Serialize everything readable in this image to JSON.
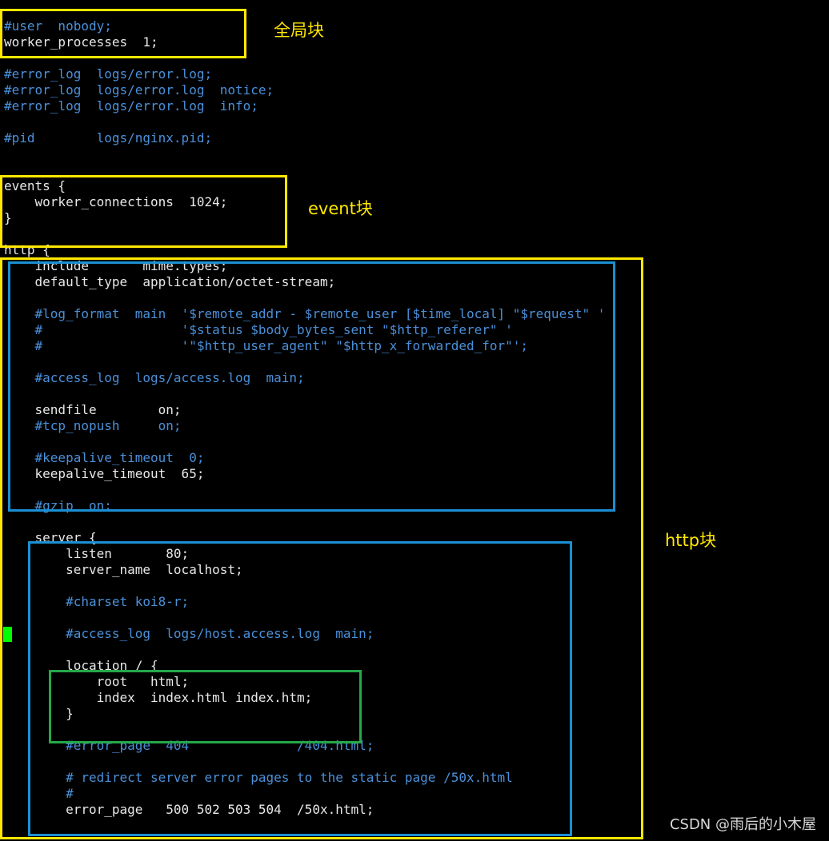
{
  "editor": {
    "lines": [
      {
        "text": "#user  nobody;",
        "kind": "comment"
      },
      {
        "text": "worker_processes  1;",
        "kind": "code"
      },
      {
        "text": "",
        "kind": "blank"
      },
      {
        "text": "#error_log  logs/error.log;",
        "kind": "comment"
      },
      {
        "text": "#error_log  logs/error.log  notice;",
        "kind": "comment"
      },
      {
        "text": "#error_log  logs/error.log  info;",
        "kind": "comment"
      },
      {
        "text": "",
        "kind": "blank"
      },
      {
        "text": "#pid        logs/nginx.pid;",
        "kind": "comment"
      },
      {
        "text": "",
        "kind": "blank"
      },
      {
        "text": "",
        "kind": "blank"
      },
      {
        "text": "events {",
        "kind": "code"
      },
      {
        "text": "    worker_connections  1024;",
        "kind": "code"
      },
      {
        "text": "}",
        "kind": "code"
      },
      {
        "text": "",
        "kind": "blank"
      },
      {
        "text": "http {",
        "kind": "code"
      },
      {
        "text": "    include       mime.types;",
        "kind": "code"
      },
      {
        "text": "    default_type  application/octet-stream;",
        "kind": "code"
      },
      {
        "text": "",
        "kind": "blank"
      },
      {
        "text": "    #log_format  main  '$remote_addr - $remote_user [$time_local] \"$request\" '",
        "kind": "comment"
      },
      {
        "text": "    #                  '$status $body_bytes_sent \"$http_referer\" '",
        "kind": "comment"
      },
      {
        "text": "    #                  '\"$http_user_agent\" \"$http_x_forwarded_for\"';",
        "kind": "comment"
      },
      {
        "text": "",
        "kind": "blank"
      },
      {
        "text": "    #access_log  logs/access.log  main;",
        "kind": "comment"
      },
      {
        "text": "",
        "kind": "blank"
      },
      {
        "text": "    sendfile        on;",
        "kind": "code"
      },
      {
        "text": "    #tcp_nopush     on;",
        "kind": "comment"
      },
      {
        "text": "",
        "kind": "blank"
      },
      {
        "text": "    #keepalive_timeout  0;",
        "kind": "comment"
      },
      {
        "text": "    keepalive_timeout  65;",
        "kind": "code"
      },
      {
        "text": "",
        "kind": "blank"
      },
      {
        "text": "    #gzip  on;",
        "kind": "comment"
      },
      {
        "text": "",
        "kind": "blank"
      },
      {
        "text": "    server {",
        "kind": "code"
      },
      {
        "text": "        listen       80;",
        "kind": "code"
      },
      {
        "text": "        server_name  localhost;",
        "kind": "code"
      },
      {
        "text": "",
        "kind": "blank"
      },
      {
        "text": "        #charset koi8-r;",
        "kind": "comment"
      },
      {
        "text": "",
        "kind": "blank"
      },
      {
        "text": "        #access_log  logs/host.access.log  main;",
        "kind": "comment"
      },
      {
        "text": "",
        "kind": "blank"
      },
      {
        "text": "        location / {",
        "kind": "code"
      },
      {
        "text": "            root   html;",
        "kind": "code"
      },
      {
        "text": "            index  index.html index.htm;",
        "kind": "code"
      },
      {
        "text": "        }",
        "kind": "code"
      },
      {
        "text": "",
        "kind": "blank"
      },
      {
        "text": "        #error_page  404              /404.html;",
        "kind": "comment"
      },
      {
        "text": "",
        "kind": "blank"
      },
      {
        "text": "        # redirect server error pages to the static page /50x.html",
        "kind": "comment"
      },
      {
        "text": "        #",
        "kind": "comment"
      },
      {
        "text": "        error_page   500 502 503 504  /50x.html;",
        "kind": "code"
      }
    ]
  },
  "annotations": {
    "global_label": "全局块",
    "event_label": "event块",
    "http_label": "http块"
  },
  "watermark": "CSDN @雨后的小木屋",
  "colors": {
    "background": "#000000",
    "code_text": "#e8e8e8",
    "comment_text": "#4a90d9",
    "yellow_box": "#ffe800",
    "blue_box": "#1b8fd2",
    "green_box": "#25a84a",
    "cursor": "#00ff00"
  }
}
